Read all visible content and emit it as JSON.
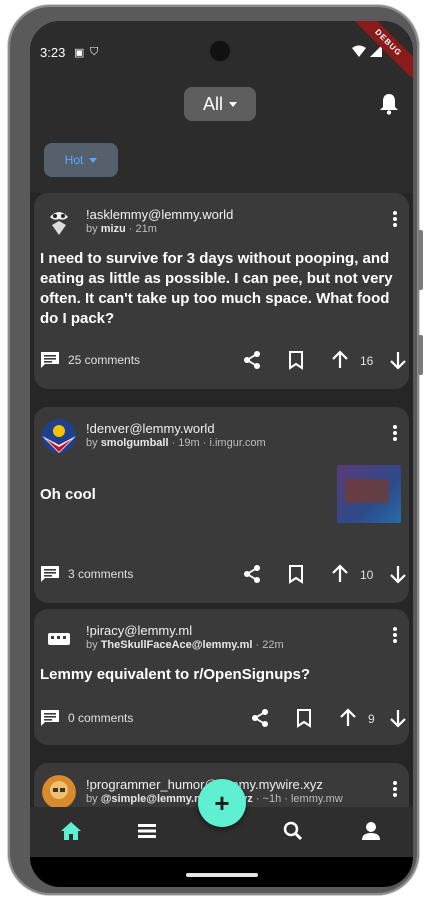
{
  "status_bar": {
    "time": "3:23",
    "debug_label": "DEBUG"
  },
  "header": {
    "feed_type": "All"
  },
  "sort": {
    "label": "Hot"
  },
  "posts": [
    {
      "community": "!asklemmy@lemmy.world",
      "author": "mizu",
      "by_prefix": "by ",
      "meta": " · 21m",
      "title": "I need to survive for 3 days without pooping, and eating as little as possible. I can pee, but not very often. It can't take up too much space. What food do I pack?",
      "comments": "25 comments",
      "score": "16",
      "avatar_icon": "asklemmy-logo-icon"
    },
    {
      "community": "!denver@lemmy.world",
      "author": "smolgumball",
      "by_prefix": "by ",
      "meta": " · 19m · i.imgur.com",
      "title": "Oh cool",
      "comments": "3 comments",
      "score": "10",
      "avatar_icon": "denver-flag-icon"
    },
    {
      "community": "!piracy@lemmy.ml",
      "author": "TheSkullFaceAce@lemmy.ml",
      "by_prefix": "by ",
      "meta": " · 22m",
      "title": "Lemmy equivalent to r/OpenSignups?",
      "comments": "0 comments",
      "score": "9",
      "avatar_icon": "pirate-flag-icon"
    },
    {
      "community": "!programmer_humor@lemmy.mywire.xyz",
      "author": "@simple@lemmy.mywire.xyz",
      "by_prefix": "by ",
      "meta": " · ~1h · lemmy.mw",
      "avatar_icon": "programmer-avatar-icon"
    }
  ],
  "colors": {
    "accent": "#5ff0d2",
    "sort_text": "#5aa7ff",
    "card": "#3a3a3a",
    "background": "#262626"
  },
  "nav": {
    "fab_label": "+",
    "icons": [
      "home-icon",
      "list-icon",
      "search-icon",
      "account-icon"
    ]
  }
}
